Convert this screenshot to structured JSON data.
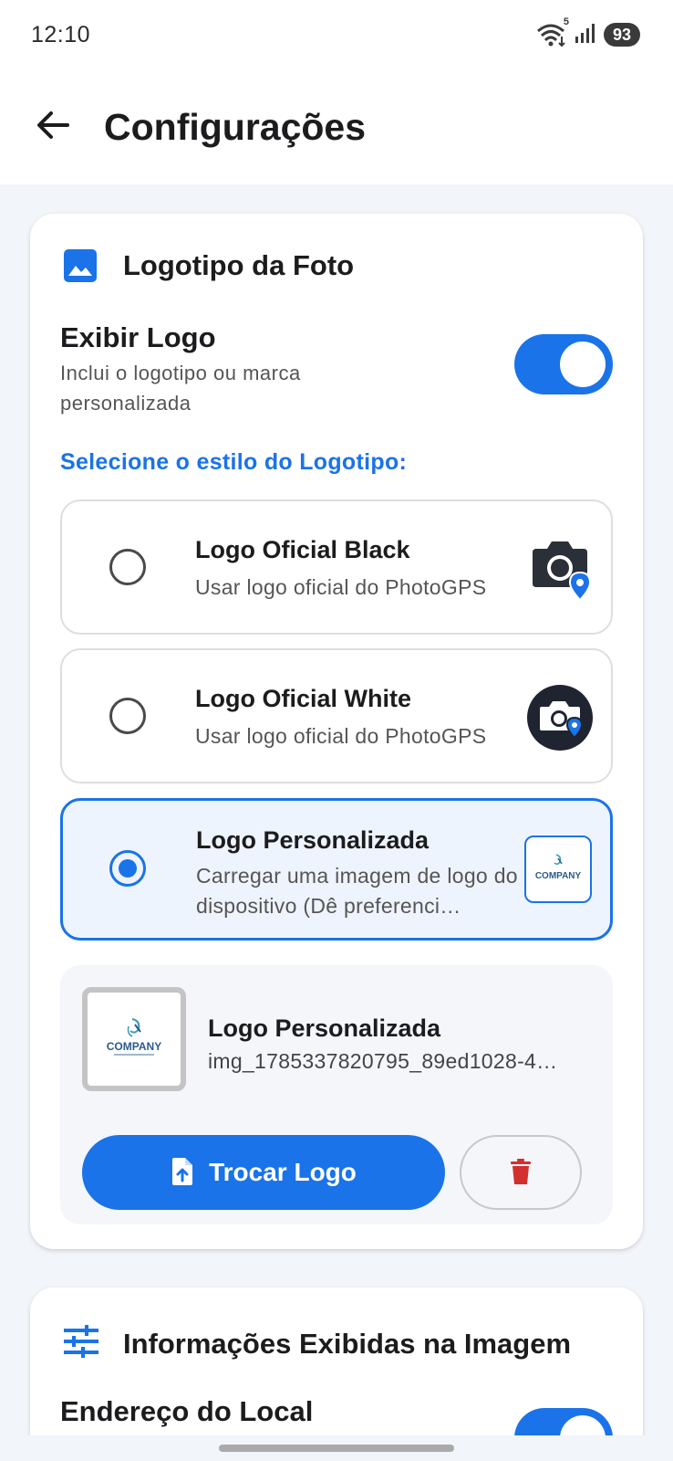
{
  "status_bar": {
    "time": "12:10",
    "battery": "93",
    "wifi_badge": "5"
  },
  "app_bar": {
    "title": "Configurações"
  },
  "logo_card": {
    "title": "Logotipo da Foto",
    "toggle": {
      "title": "Exibir Logo",
      "description": "Inclui o logotipo ou marca personalizada",
      "on": true
    },
    "section_label": "Selecione o estilo do Logotipo:",
    "options": [
      {
        "title": "Logo Oficial Black",
        "description": "Usar logo oficial do PhotoGPS",
        "selected": false
      },
      {
        "title": "Logo Oficial White",
        "description": "Usar logo oficial do PhotoGPS",
        "selected": false
      },
      {
        "title": "Logo Personalizada",
        "description": "Carregar uma imagem de logo do dispositivo (Dê preferenci…",
        "selected": true
      }
    ],
    "custom": {
      "title": "Logo Personalizada",
      "filename": "img_1785337820795_89ed1028-4…",
      "change_label": "Trocar Logo",
      "logo_text": "COMPANY"
    }
  },
  "info_card": {
    "title": "Informações Exibidas na Imagem",
    "address_label": "Endereço do Local"
  },
  "colors": {
    "accent": "#1a73e8",
    "delete": "#d32f2f"
  }
}
